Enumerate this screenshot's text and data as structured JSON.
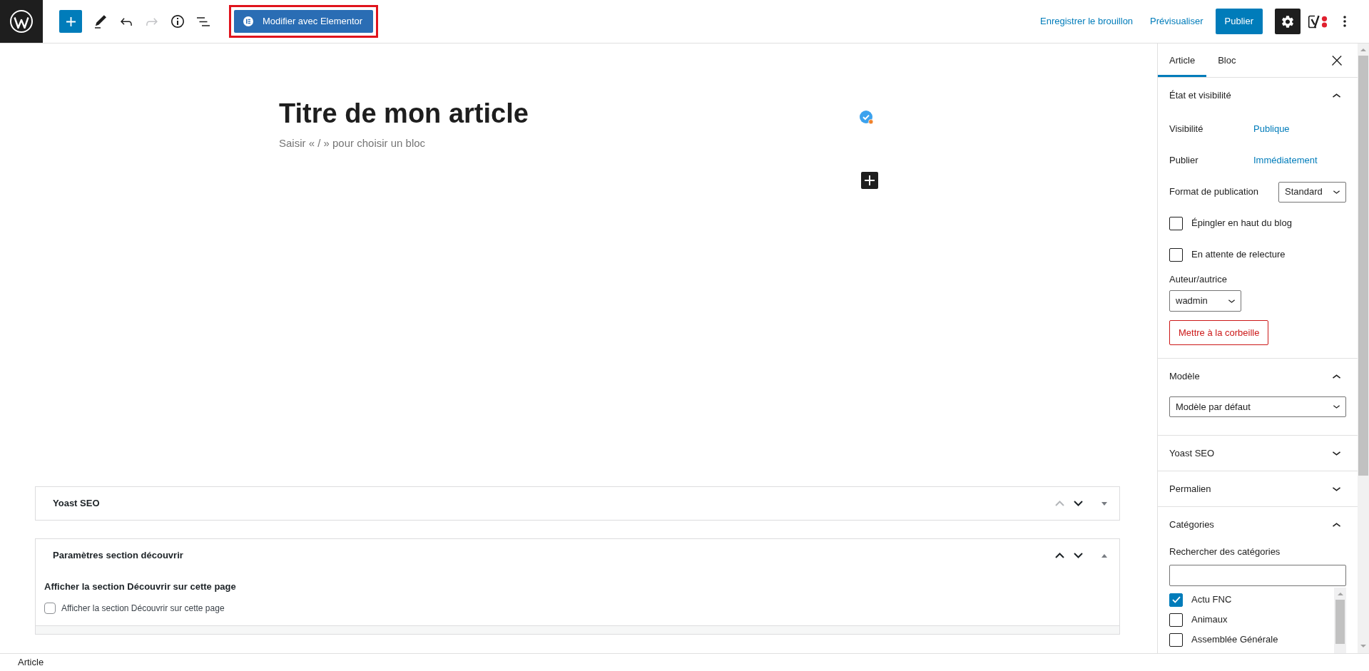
{
  "top_bar": {
    "tools": [
      {
        "kind": "add",
        "disabled": false
      },
      {
        "kind": "tools",
        "disabled": false
      },
      {
        "kind": "undo",
        "disabled": false
      },
      {
        "kind": "redo",
        "disabled": true
      },
      {
        "kind": "details",
        "disabled": false
      },
      {
        "kind": "list_view",
        "disabled": false
      }
    ],
    "elementor": {
      "label": "Modifier avec Elementor",
      "highlighted": true
    },
    "save_draft": "Enregistrer le brouillon",
    "preview": "Prévisualiser",
    "publish": "Publier",
    "settings_pressed": true
  },
  "editor": {
    "title": "Titre de mon article",
    "empty_block_hint": "Saisir « / » pour choisir un bloc"
  },
  "metaboxes": [
    {
      "title": "Yoast SEO",
      "expanded": false,
      "up_disabled": true
    },
    {
      "title": "Paramètres section découvrir",
      "expanded": true,
      "up_disabled": false,
      "heading": "Afficher la section Découvrir sur cette page",
      "option": {
        "label": "Afficher la section Découvrir sur cette page",
        "checked": false
      }
    }
  ],
  "sidebar": {
    "tabs": [
      {
        "label": "Article",
        "selected": true
      },
      {
        "label": "Bloc",
        "selected": false
      }
    ],
    "panels": [
      {
        "title": "État et visibilité",
        "expanded": true,
        "rows": [
          {
            "kind": "link",
            "label": "Visibilité",
            "value": "Publique"
          },
          {
            "kind": "link",
            "label": "Publier",
            "value": "Immédiatement"
          },
          {
            "kind": "select",
            "label": "Format de publication",
            "value": "Standard"
          },
          {
            "kind": "checkbox",
            "label": "Épingler en haut du blog",
            "checked": false
          },
          {
            "kind": "checkbox",
            "label": "En attente de relecture",
            "checked": false
          },
          {
            "kind": "stacked_select",
            "label": "Auteur/autrice",
            "value": "wadmin"
          },
          {
            "kind": "danger_button",
            "label": "Mettre à la corbeille"
          }
        ]
      },
      {
        "title": "Modèle",
        "expanded": true,
        "rows": [
          {
            "kind": "wide_select",
            "value": "Modèle par défaut"
          }
        ]
      },
      {
        "title": "Yoast SEO",
        "expanded": false
      },
      {
        "title": "Permalien",
        "expanded": false
      },
      {
        "title": "Catégories",
        "expanded": true,
        "rows": [
          {
            "kind": "search",
            "label": "Rechercher des catégories"
          },
          {
            "kind": "checklist",
            "items": [
              {
                "label": "Actu FNC",
                "checked": true
              },
              {
                "label": "Animaux",
                "checked": false
              },
              {
                "label": "Assemblée Générale",
                "checked": false
              }
            ]
          }
        ]
      }
    ]
  },
  "status_bar": {
    "breadcrumb": "Article"
  }
}
